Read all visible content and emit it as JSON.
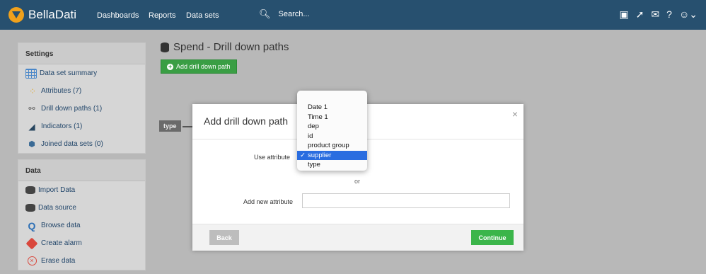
{
  "header": {
    "app_name": "BellaDati",
    "nav": [
      "Dashboards",
      "Reports",
      "Data sets"
    ],
    "search_placeholder": "Search..."
  },
  "sidebar": {
    "settings_title": "Settings",
    "settings_items": [
      {
        "label": "Data set summary",
        "icon": "table-grid-icon"
      },
      {
        "label": "Attributes (7)",
        "icon": "attributes-dots-icon"
      },
      {
        "label": "Drill down paths (1)",
        "icon": "hierarchy-icon"
      },
      {
        "label": "Indicators (1)",
        "icon": "gauge-icon"
      },
      {
        "label": "Joined data sets (0)",
        "icon": "join-icon"
      }
    ],
    "data_title": "Data",
    "data_items": [
      {
        "label": "Import Data",
        "icon": "import-database-icon"
      },
      {
        "label": "Data source",
        "icon": "database-icon"
      },
      {
        "label": "Browse data",
        "icon": "magnifier-icon"
      },
      {
        "label": "Create alarm",
        "icon": "alarm-icon"
      },
      {
        "label": "Erase data",
        "icon": "erase-icon"
      }
    ]
  },
  "content": {
    "title": "Spend - Drill down paths",
    "add_button": "Add drill down path",
    "type_tag": "type"
  },
  "modal": {
    "title": "Add drill down path",
    "close": "×",
    "use_attribute_label": "Use attribute",
    "or": "or",
    "add_new_label": "Add new attribute",
    "new_attribute_value": "",
    "back": "Back",
    "continue": "Continue"
  },
  "dropdown": {
    "options": [
      "Date 1",
      "Time 1",
      "dep",
      "id",
      "product group",
      "supplier",
      "type"
    ],
    "selected": "supplier",
    "check": "✓"
  },
  "colors": {
    "topbar": "#27506f",
    "primary_button": "#3bb54a",
    "selection": "#2a6de0"
  }
}
